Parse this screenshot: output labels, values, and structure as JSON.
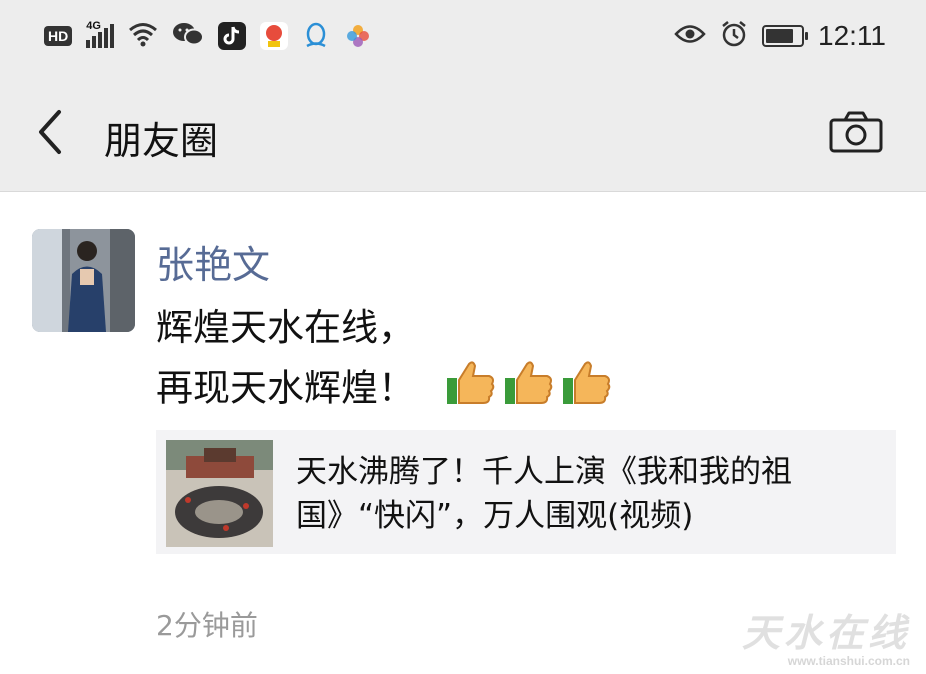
{
  "status_bar": {
    "network_badge": "HD",
    "network_type": "4G",
    "time": "12:11",
    "icons": [
      "signal-icon",
      "wifi-icon",
      "wechat-icon",
      "tiktok-icon",
      "app-icon",
      "qq-icon",
      "photos-icon",
      "eye-icon",
      "alarm-icon",
      "battery-icon"
    ]
  },
  "nav": {
    "title": "朋友圈",
    "back_icon": "chevron-left-icon",
    "camera_icon": "camera-icon"
  },
  "post": {
    "author": "张艳文",
    "line1": "辉煌天水在线，",
    "line2": "再现天水辉煌！",
    "emoji_count": 3,
    "link": {
      "title": "天水沸腾了！千人上演《我和我的祖国》“快闪”，万人围观(视频)"
    },
    "time": "2分钟前"
  },
  "watermark": {
    "text": "天水在线",
    "url": "www.tianshui.com.cn"
  },
  "colors": {
    "bar_bg": "#ededed",
    "author": "#576b95",
    "time": "#9a9a9a",
    "card_bg": "#f3f3f5"
  }
}
